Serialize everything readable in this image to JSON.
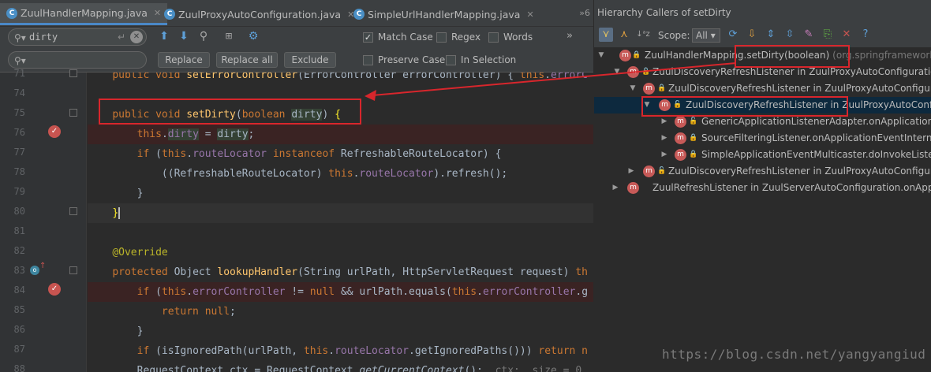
{
  "tabs": [
    {
      "label": "ZuulHandlerMapping.java",
      "active": true
    },
    {
      "label": "ZuulProxyAutoConfiguration.java",
      "active": false
    },
    {
      "label": "SimpleUrlHandlerMapping.java",
      "active": false
    }
  ],
  "tab_overflow": "»6",
  "find": {
    "search_value": "dirty",
    "replace_value": "",
    "match_case": {
      "label": "Match Case",
      "checked": true
    },
    "regex": {
      "label": "Regex",
      "checked": false
    },
    "words": {
      "label": "Words",
      "checked": false
    },
    "preserve_case": {
      "label": "Preserve Case",
      "checked": false
    },
    "in_selection": {
      "label": "In Selection",
      "checked": false
    },
    "replace_btn": "Replace",
    "replace_all_btn": "Replace all",
    "exclude_btn": "Exclude",
    "more": "»"
  },
  "line_numbers": [
    "71",
    "74",
    "75",
    "76",
    "77",
    "78",
    "79",
    "80",
    "81",
    "82",
    "83",
    "84",
    "85",
    "86",
    "87",
    "88"
  ],
  "hierarchy": {
    "title": "Hierarchy Callers of setDirty",
    "scope_label": "Scope:",
    "scope_value": "All",
    "nodes": [
      {
        "text": "ZuulHandlerMapping.setDirty(boolean)",
        "pkg": "(org.springframework"
      },
      {
        "text": "ZuulDiscoveryRefreshListener in ZuulProxyAutoConfiguration.",
        "pkg": ""
      },
      {
        "text": "ZuulDiscoveryRefreshListener in ZuulProxyAutoConfigurat",
        "pkg": ""
      },
      {
        "text": "ZuulDiscoveryRefreshListener in ZuulProxyAutoConfigu",
        "pkg": ""
      },
      {
        "text": "GenericApplicationListenerAdapter.onApplicationE",
        "pkg": ""
      },
      {
        "text": "SourceFilteringListener.onApplicationEventInternal",
        "pkg": ""
      },
      {
        "text": "SimpleApplicationEventMulticaster.doInvokeListene",
        "pkg": ""
      },
      {
        "text": "ZuulDiscoveryRefreshListener in ZuulProxyAutoConfigurat",
        "pkg": ""
      },
      {
        "text": "ZuulRefreshListener in ZuulServerAutoConfiguration.onApplic",
        "pkg": ""
      }
    ]
  },
  "watermark": "https://blog.csdn.net/yangyangiud",
  "colors": {
    "accent": "#4a88c7",
    "annotation_red": "#d8262c",
    "breakpoint": "#c75450"
  }
}
